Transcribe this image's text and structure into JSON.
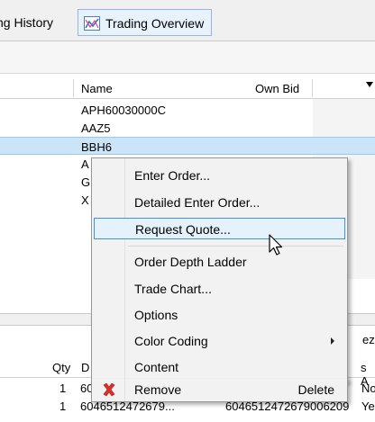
{
  "tabs": [
    {
      "label": "ng History"
    },
    {
      "label": "Trading Overview",
      "icon": "trading-overview-chart-icon"
    }
  ],
  "grid": {
    "columns": {
      "name": "Name",
      "own_bid": "Own Bid"
    },
    "rows": [
      {
        "name": "APH60030000C"
      },
      {
        "name": "AAZ5"
      },
      {
        "name": "BBH6"
      },
      {
        "name": "A"
      },
      {
        "name": "G."
      },
      {
        "name": "X"
      }
    ]
  },
  "context_menu": {
    "items": [
      {
        "label": "Enter Order..."
      },
      {
        "label": "Detailed Enter Order..."
      },
      {
        "label": "Request Quote..."
      },
      {
        "label": "Order Depth Ladder"
      },
      {
        "label": "Trade Chart..."
      },
      {
        "label": "Options"
      },
      {
        "label": "Color Coding"
      },
      {
        "label": "Content"
      },
      {
        "label": "Remove",
        "shortcut": "Delete",
        "icon": "remove-x-icon"
      }
    ]
  },
  "lower": {
    "tail_text": "ez",
    "headers": {
      "qty": "Qty",
      "d": "D",
      "s_a": "s A"
    },
    "rows": [
      {
        "qty": "1",
        "id1": "60",
        "tail": "No"
      },
      {
        "qty": "1",
        "id1": "604651247267​9...",
        "id2": "604651247267​9006209",
        "tail": "Yes"
      }
    ]
  },
  "colors": {
    "highlight_border": "#3c93e0",
    "selection": "#cce4f7",
    "remove_red": "#d9302c"
  }
}
